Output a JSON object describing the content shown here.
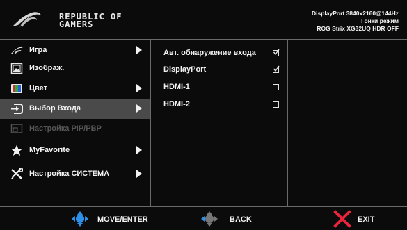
{
  "header": {
    "brand_line1": "REPUBLIC OF",
    "brand_line2": "GAMERS",
    "status_line1": "DisplayPort 3840x2160@144Hz",
    "status_line2": "Гонки режим",
    "status_line3": "ROG Strix XG32UQ HDR OFF"
  },
  "menu": {
    "items": [
      {
        "label": "Игра",
        "icon": "game-icon"
      },
      {
        "label": "Изображ.",
        "icon": "image-icon"
      },
      {
        "label": "Цвет",
        "icon": "color-icon"
      },
      {
        "label": "Выбор Входа",
        "icon": "input-select-icon"
      },
      {
        "label": "Настройка PIP/PBP",
        "icon": "pip-icon"
      },
      {
        "label": "MyFavorite",
        "icon": "star-icon"
      },
      {
        "label": "Настройка СИСТЕМА",
        "icon": "tools-icon"
      }
    ],
    "selected": "Выбор Входа",
    "disabled": "Настройка PIP/PBP"
  },
  "submenu": {
    "items": [
      {
        "label": "Авт. обнаружение входа",
        "checked": true
      },
      {
        "label": "DisplayPort",
        "checked": true
      },
      {
        "label": "HDMI-1",
        "checked": false
      },
      {
        "label": "HDMI-2",
        "checked": false
      }
    ]
  },
  "footer": {
    "move_label": "MOVE/ENTER",
    "back_label": "BACK",
    "exit_label": "EXIT"
  },
  "colors": {
    "background": "#0b0b0b",
    "divider": "#6a6a6a",
    "selected_row": "#4a4a4a",
    "joystick_blue": "#2f8fe6",
    "exit_red": "#e8253c"
  }
}
